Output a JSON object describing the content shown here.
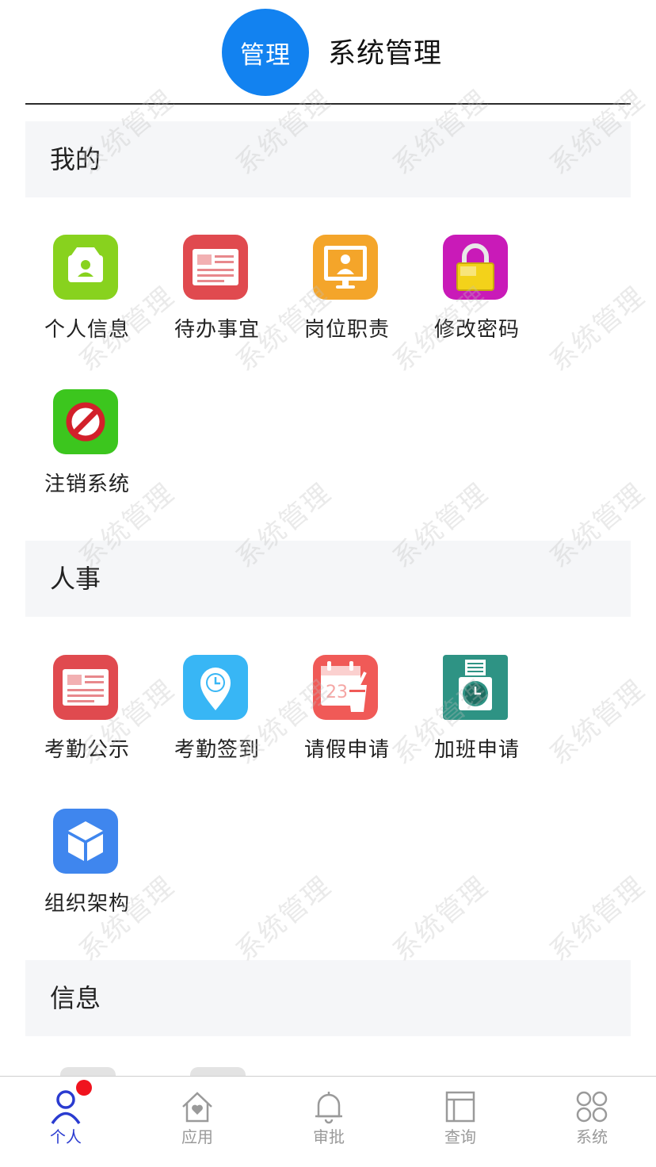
{
  "header": {
    "logo_text": "管理",
    "app_title": "系统管理"
  },
  "watermark_text": "系统管理",
  "sections": [
    {
      "title": "我的",
      "items": [
        {
          "label": "个人信息",
          "icon": "profile-card-icon",
          "color": "#88d21e"
        },
        {
          "label": "待办事宜",
          "icon": "todo-document-icon",
          "color": "#e04a4f"
        },
        {
          "label": "岗位职责",
          "icon": "position-duty-icon",
          "color": "#f4a52a"
        },
        {
          "label": "修改密码",
          "icon": "lock-icon",
          "color": "#c91ab8"
        },
        {
          "label": "注销系统",
          "icon": "logout-forbidden-icon",
          "color": "#3cc61e"
        }
      ]
    },
    {
      "title": "人事",
      "items": [
        {
          "label": "考勤公示",
          "icon": "attendance-notice-icon",
          "color": "#e04a4f"
        },
        {
          "label": "考勤签到",
          "icon": "clock-in-location-icon",
          "color": "#38b6f5"
        },
        {
          "label": "请假申请",
          "icon": "leave-calendar-icon",
          "color": "#f05a57"
        },
        {
          "label": "加班申请",
          "icon": "overtime-clock-icon",
          "color": "#2e9384"
        },
        {
          "label": "组织架构",
          "icon": "organization-cube-icon",
          "color": "#3f86ee"
        }
      ]
    },
    {
      "title": "信息",
      "items": []
    }
  ],
  "tabbar": {
    "tabs": [
      {
        "label": "个人",
        "icon": "person-icon",
        "active": true
      },
      {
        "label": "应用",
        "icon": "home-heart-icon",
        "active": false
      },
      {
        "label": "审批",
        "icon": "bell-icon",
        "active": false
      },
      {
        "label": "查询",
        "icon": "panel-layout-icon",
        "active": false
      },
      {
        "label": "系统",
        "icon": "apps-grid-icon",
        "active": false
      }
    ]
  },
  "colors": {
    "brand_blue": "#1282f0",
    "active_tab": "#2a3bd0",
    "badge_red": "#f0131e",
    "section_bg": "#f5f6f8"
  }
}
